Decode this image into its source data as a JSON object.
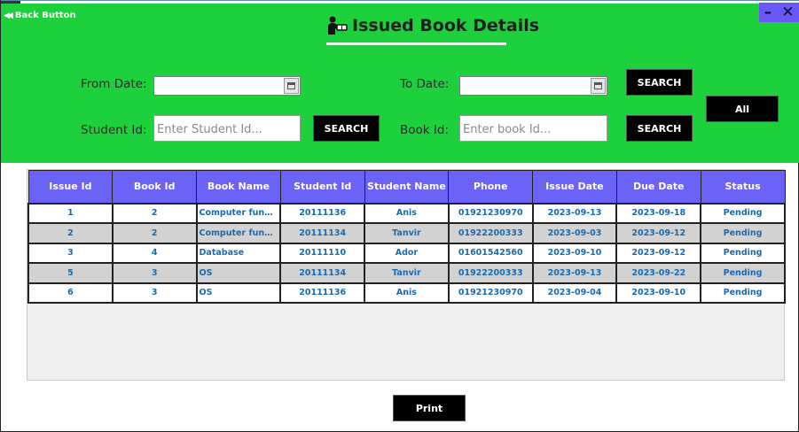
{
  "window": {
    "back_label": "Back Button",
    "title": "Issued Book Details",
    "minimize_glyph": "–",
    "close_glyph": "✕",
    "header_color": "#1dd13d",
    "accent_color": "#6b63f7"
  },
  "filters": {
    "from_date_label": "From Date:",
    "from_date_value": "",
    "to_date_label": "To Date:",
    "to_date_value": "",
    "date_search_label": "SEARCH",
    "student_id_label": "Student Id:",
    "student_id_placeholder": "Enter Student Id...",
    "student_search_label": "SEARCH",
    "book_id_label": "Book Id:",
    "book_id_placeholder": "Enter book Id...",
    "book_search_label": "SEARCH",
    "all_label": "All"
  },
  "table": {
    "columns": [
      "Issue Id",
      "Book Id",
      "Book Name",
      "Student Id",
      "Student Name",
      "Phone",
      "Issue Date",
      "Due Date",
      "Status"
    ],
    "rows": [
      [
        "1",
        "2",
        "Computer funda...",
        "20111136",
        "Anis",
        "01921230970",
        "2023-09-13",
        "2023-09-18",
        "Pending"
      ],
      [
        "2",
        "2",
        "Computer funda...",
        "20111134",
        "Tanvir",
        "01922200333",
        "2023-09-03",
        "2023-09-12",
        "Pending"
      ],
      [
        "3",
        "4",
        "Database",
        "20111110",
        "Ador",
        "01601542560",
        "2023-09-10",
        "2023-09-12",
        "Pending"
      ],
      [
        "5",
        "3",
        "OS",
        "20111134",
        "Tanvir",
        "01922200333",
        "2023-09-13",
        "2023-09-22",
        "Pending"
      ],
      [
        "6",
        "3",
        "OS",
        "20111136",
        "Anis",
        "01921230970",
        "2023-09-04",
        "2023-09-10",
        "Pending"
      ]
    ]
  },
  "footer": {
    "print_label": "Print"
  },
  "icons": {
    "back": "double-left-arrow-icon",
    "title": "reader-book-icon",
    "calendar": "calendar-icon"
  }
}
